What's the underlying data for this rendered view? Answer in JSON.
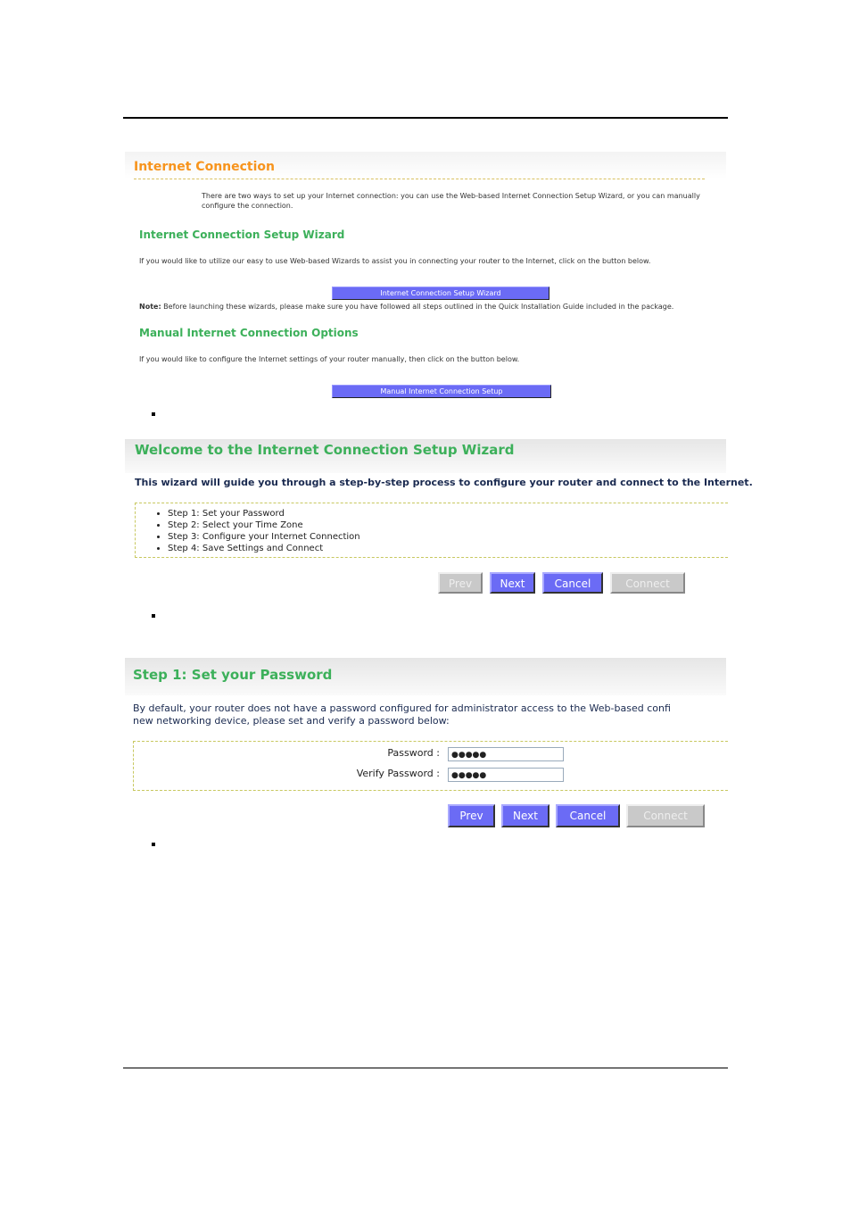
{
  "internet_connection": {
    "title": "Internet Connection",
    "intro": "There are two ways to set up your Internet connection: you can use the Web-based Internet Connection Setup Wizard, or you can manually configure the connection.",
    "wizard_heading": "Internet Connection Setup Wizard",
    "wizard_text": "If you would like to utilize our easy to use Web-based Wizards to assist you in connecting your router to the Internet, click on the button below.",
    "wizard_button": "Internet Connection Setup Wizard",
    "note_label": "Note:",
    "note_text": " Before launching these wizards, please make sure you have followed all steps outlined in the Quick Installation Guide included in the package.",
    "manual_heading": "Manual Internet Connection Options",
    "manual_text": "If you would like to configure the Internet settings of your router manually, then click on the button below.",
    "manual_button": "Manual Internet Connection Setup"
  },
  "welcome": {
    "title": "Welcome to the Internet Connection Setup Wizard",
    "intro": "This wizard will guide you through a step-by-step process to configure your router and connect to the Internet.",
    "steps": [
      "Step 1: Set your Password",
      "Step 2: Select your Time Zone",
      "Step 3: Configure your Internet Connection",
      "Step 4: Save Settings and Connect"
    ],
    "buttons": {
      "prev": "Prev",
      "next": "Next",
      "cancel": "Cancel",
      "connect": "Connect"
    }
  },
  "step1": {
    "title": "Step 1: Set your Password",
    "intro_line1": "By default, your router does not have a password configured for administrator access to the Web-based confi",
    "intro_line2": "new networking device, please set and verify a password below:",
    "password_label": "Password :",
    "password_value": "●●●●●",
    "verify_label": "Verify Password :",
    "verify_value": "●●●●●",
    "buttons": {
      "prev": "Prev",
      "next": "Next",
      "cancel": "Cancel",
      "connect": "Connect"
    }
  },
  "colors": {
    "orange": "#f7941d",
    "green": "#3cb05a",
    "button": "#6b6bf5",
    "disabled": "#c9c9c9"
  }
}
